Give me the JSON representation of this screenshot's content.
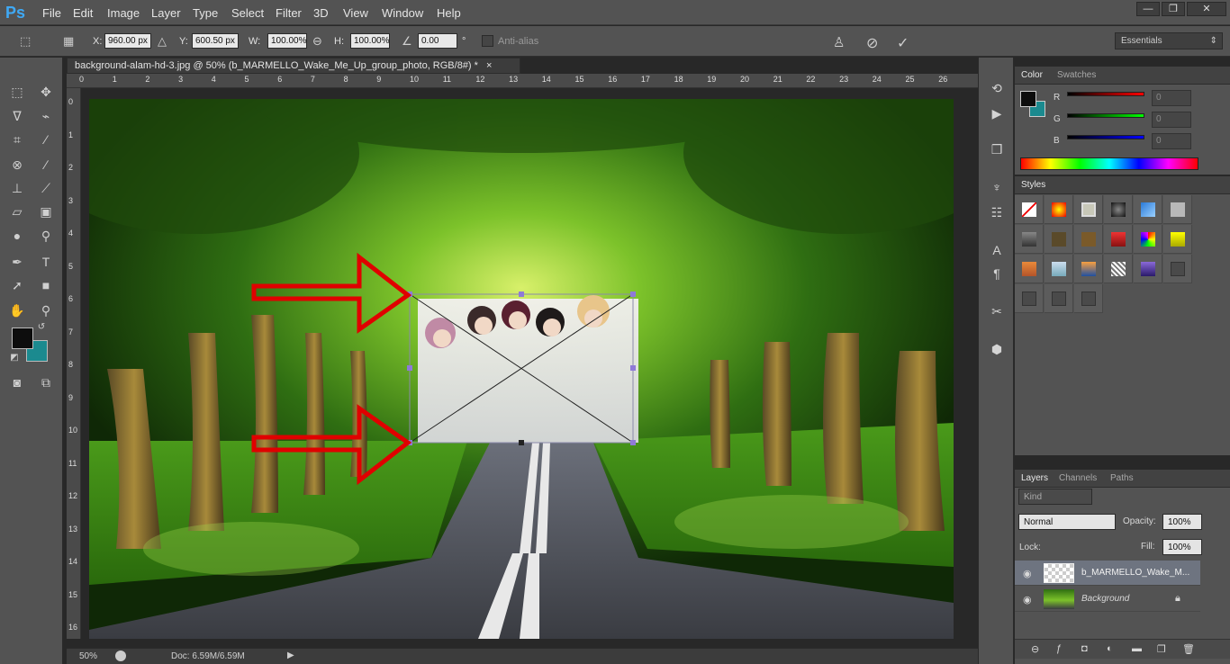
{
  "app": {
    "logo": "Ps"
  },
  "menu": [
    "File",
    "Edit",
    "Image",
    "Layer",
    "Type",
    "Select",
    "Filter",
    "3D",
    "View",
    "Window",
    "Help"
  ],
  "window_controls": [
    "—",
    "❐",
    "✕"
  ],
  "options": {
    "x_label": "X:",
    "x_value": "960.00 px",
    "y_label": "Y:",
    "y_value": "600.50 px",
    "w_label": "W:",
    "w_value": "100.00%",
    "h_label": "H:",
    "h_value": "100.00%",
    "angle_value": "0.00",
    "degree": "°",
    "antialias_label": "Anti-alias",
    "workspace": "Essentials"
  },
  "document": {
    "tab_title": "background-alam-hd-3.jpg @ 50% (b_MARMELLO_Wake_Me_Up_group_photo, RGB/8#) *",
    "close": "×",
    "zoom": "50%",
    "doc_size": "Doc: 6.59M/6.59M",
    "ruler_top": [
      "0",
      "1",
      "2",
      "3",
      "4",
      "5",
      "6",
      "7",
      "8",
      "9",
      "10",
      "11",
      "12",
      "13",
      "14",
      "15",
      "16",
      "17",
      "18",
      "19",
      "20",
      "21",
      "22",
      "23",
      "24",
      "25",
      "26"
    ],
    "ruler_left": [
      "0",
      "1",
      "2",
      "3",
      "4",
      "5",
      "6",
      "7",
      "8",
      "9",
      "10",
      "11",
      "12",
      "13",
      "14",
      "15",
      "16"
    ]
  },
  "color_panel": {
    "tabs": [
      "Color",
      "Swatches"
    ],
    "r_label": "R",
    "g_label": "G",
    "b_label": "B",
    "r_value": "0",
    "g_value": "0",
    "b_value": "0"
  },
  "styles_panel": {
    "tab": "Styles"
  },
  "layers_panel": {
    "tabs": [
      "Layers",
      "Channels",
      "Paths"
    ],
    "kind_label": "Kind",
    "blend_mode": "Normal",
    "opacity_label": "Opacity:",
    "opacity_value": "100%",
    "lock_label": "Lock:",
    "fill_label": "Fill:",
    "fill_value": "100%",
    "layers": [
      {
        "name": "b_MARMELLO_Wake_M..."
      },
      {
        "name": "Background"
      }
    ]
  },
  "colors": {
    "foreground": "#0d0d0d",
    "background": "#1b8a8f",
    "accent_red": "#e00000"
  }
}
